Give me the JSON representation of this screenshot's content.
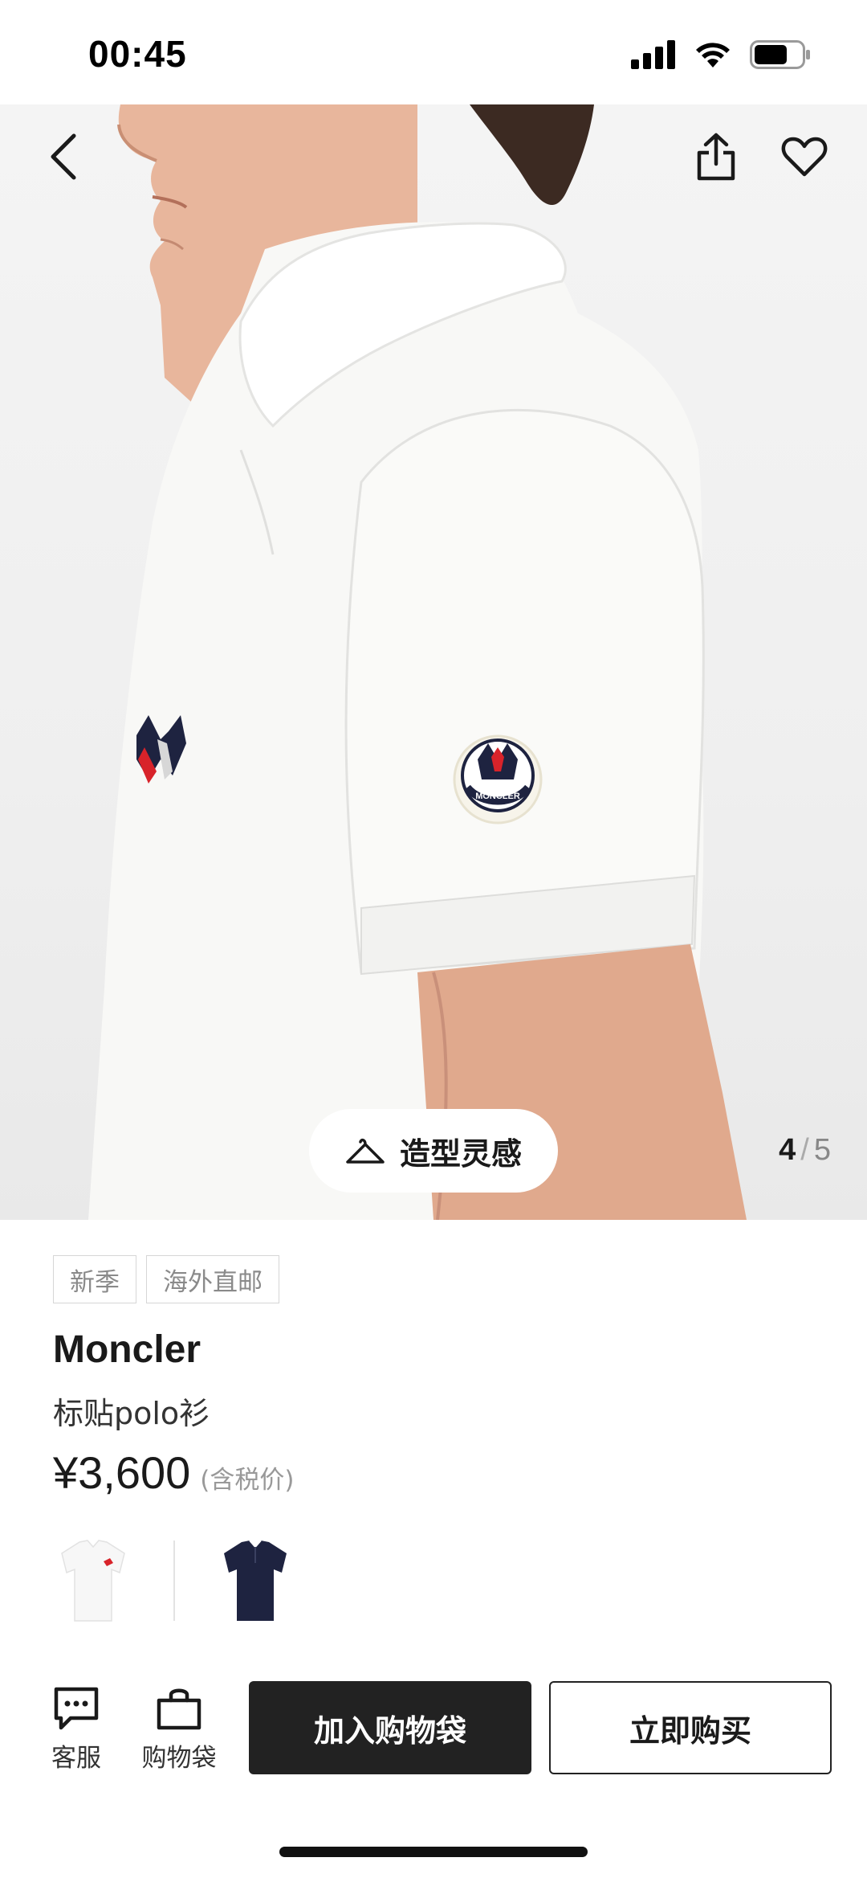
{
  "status_bar": {
    "time": "00:45",
    "icons": [
      "signal-icon",
      "wifi-icon",
      "battery-icon"
    ]
  },
  "header": {
    "icons": [
      "back-icon",
      "share-icon",
      "heart-icon"
    ]
  },
  "gallery": {
    "styling_button_label": "造型灵感",
    "styling_icon": "hanger-icon",
    "current_page": "4",
    "separator": "/",
    "total_pages": "5",
    "patch_text": "MONCLER"
  },
  "product": {
    "tags": [
      "新季",
      "海外直邮"
    ],
    "brand": "Moncler",
    "name": "标贴polo衫",
    "price": "¥3,600",
    "tax_note": "(含税价)",
    "colors": [
      {
        "name": "white-polo-swatch",
        "color": "#f7f7f7"
      },
      {
        "name": "navy-polo-swatch",
        "color": "#1e2340"
      }
    ]
  },
  "actions": {
    "service_label": "客服",
    "bag_label": "购物袋",
    "add_to_bag_label": "加入购物袋",
    "buy_now_label": "立即购买"
  },
  "colors": {
    "primary_button": "#222222",
    "accent_red": "#d8232a",
    "accent_navy": "#1e2340"
  }
}
